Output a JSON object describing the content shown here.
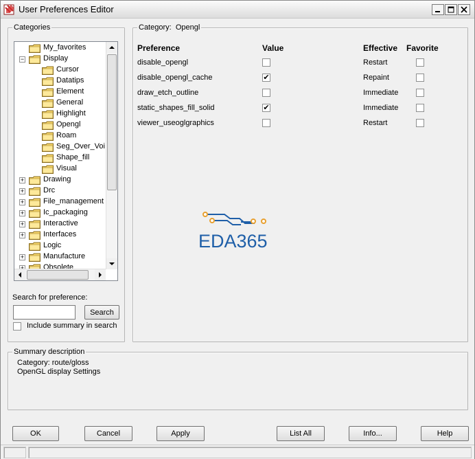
{
  "window": {
    "title": "User Preferences Editor",
    "controls": {
      "minimize": "_",
      "maximize": "□",
      "close": "✕"
    }
  },
  "categories": {
    "legend": "Categories",
    "tree": [
      {
        "label": "My_favorites",
        "level": 1,
        "expander": ""
      },
      {
        "label": "Display",
        "level": 1,
        "expander": "−"
      },
      {
        "label": "Cursor",
        "level": 2,
        "expander": ""
      },
      {
        "label": "Datatips",
        "level": 2,
        "expander": ""
      },
      {
        "label": "Element",
        "level": 2,
        "expander": ""
      },
      {
        "label": "General",
        "level": 2,
        "expander": ""
      },
      {
        "label": "Highlight",
        "level": 2,
        "expander": ""
      },
      {
        "label": "Opengl",
        "level": 2,
        "expander": ""
      },
      {
        "label": "Roam",
        "level": 2,
        "expander": ""
      },
      {
        "label": "Seg_Over_Voi",
        "level": 2,
        "expander": ""
      },
      {
        "label": "Shape_fill",
        "level": 2,
        "expander": ""
      },
      {
        "label": "Visual",
        "level": 2,
        "expander": ""
      },
      {
        "label": "Drawing",
        "level": 1,
        "expander": "+"
      },
      {
        "label": "Drc",
        "level": 1,
        "expander": "+"
      },
      {
        "label": "File_management",
        "level": 1,
        "expander": "+"
      },
      {
        "label": "Ic_packaging",
        "level": 1,
        "expander": "+"
      },
      {
        "label": "Interactive",
        "level": 1,
        "expander": "+"
      },
      {
        "label": "Interfaces",
        "level": 1,
        "expander": "+"
      },
      {
        "label": "Logic",
        "level": 1,
        "expander": ""
      },
      {
        "label": "Manufacture",
        "level": 1,
        "expander": "+"
      },
      {
        "label": "Obsolete",
        "level": 1,
        "expander": "+"
      }
    ],
    "search_label": "Search for preference:",
    "search_value": "",
    "search_button": "Search",
    "include_summary_label": "Include summary in search",
    "include_summary_checked": false
  },
  "preferences": {
    "legend_prefix": "Category:",
    "category": "Opengl",
    "headers": {
      "preference": "Preference",
      "value": "Value",
      "effective": "Effective",
      "favorite": "Favorite"
    },
    "rows": [
      {
        "name": "disable_opengl",
        "value": "",
        "effective": "Restart",
        "favorite": ""
      },
      {
        "name": "disable_opengl_cache",
        "value": "✔",
        "effective": "Repaint",
        "favorite": ""
      },
      {
        "name": "draw_etch_outline",
        "value": "",
        "effective": "Immediate",
        "favorite": ""
      },
      {
        "name": "static_shapes_fill_solid",
        "value": "✔",
        "effective": "Immediate",
        "favorite": ""
      },
      {
        "name": "viewer_useoglgraphics",
        "value": "",
        "effective": "Restart",
        "favorite": ""
      }
    ],
    "watermark": "EDA365"
  },
  "summary": {
    "legend": "Summary description",
    "line1": "Category: route/gloss",
    "line2": "OpenGL display Settings"
  },
  "buttons": {
    "ok": "OK",
    "cancel": "Cancel",
    "apply": "Apply",
    "list_all": "List All",
    "info": "Info...",
    "help": "Help"
  },
  "colors": {
    "watermark_blue": "#1f5fa8",
    "watermark_orange": "#e8a030",
    "folder_yellow": "#f7d66b"
  }
}
